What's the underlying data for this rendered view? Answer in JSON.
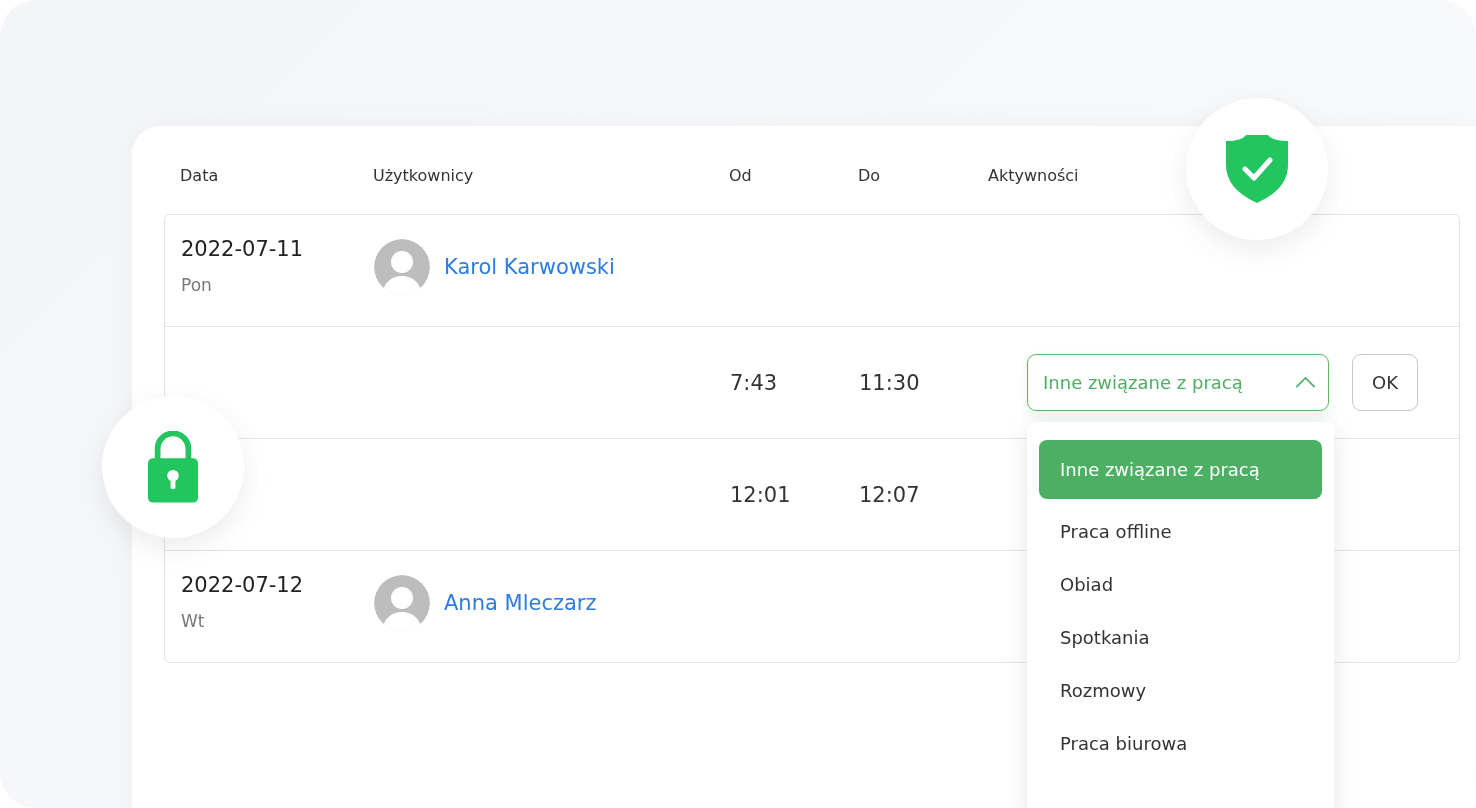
{
  "columns": [
    "Data",
    "Użytkownicy",
    "Od",
    "Do",
    "Aktywności"
  ],
  "rows": [
    {
      "kind": "user",
      "date": "2022-07-11",
      "weekday": "Pon",
      "user": "Karol Karwowski"
    },
    {
      "kind": "entry",
      "from": "7:43",
      "to": "11:30",
      "activity": "Inne związane z pracą",
      "expanded": true,
      "button": "OK",
      "options": [
        {
          "label": "Inne związane z pracą",
          "selected": true
        },
        {
          "label": "Praca offline",
          "selected": false
        },
        {
          "label": "Obiad",
          "selected": false
        },
        {
          "label": "Spotkania",
          "selected": false
        },
        {
          "label": "Rozmowy",
          "selected": false
        },
        {
          "label": "Praca biurowa",
          "selected": false
        }
      ]
    },
    {
      "kind": "entry",
      "from": "12:01",
      "to": "12:07"
    },
    {
      "kind": "user",
      "date": "2022-07-12",
      "weekday": "Wt",
      "user": "Anna Mleczarz"
    }
  ]
}
